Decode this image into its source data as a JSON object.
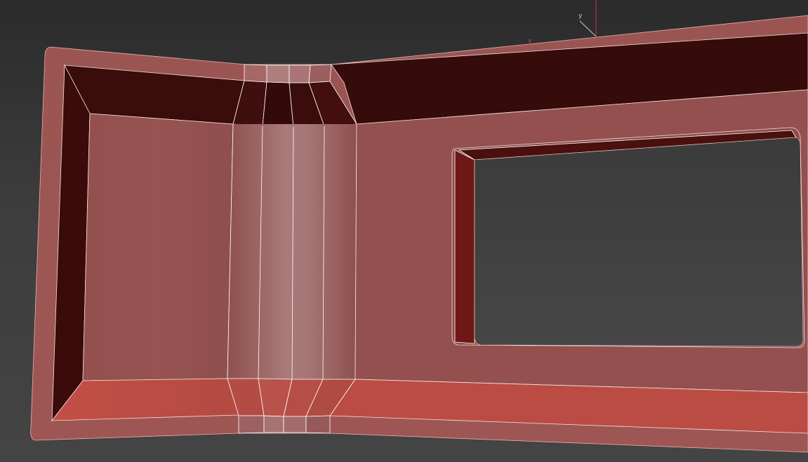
{
  "viewport": {
    "background_top": "#2b2b2b",
    "background_bottom": "#444444",
    "object_color": "#95524f",
    "wire_color": "#ffffff"
  },
  "gizmo": {
    "y_label": "y",
    "x_label": "x",
    "x_axis_color": "#c0393b",
    "y_axis_color": "#c8c8c8"
  }
}
